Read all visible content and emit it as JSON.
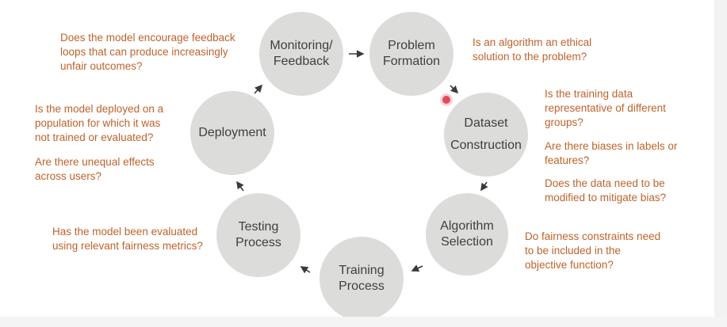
{
  "stages": [
    {
      "id": "monitoring",
      "lines": [
        "Monitoring/",
        "Feedback"
      ]
    },
    {
      "id": "problem",
      "lines": [
        "Problem",
        "Formation"
      ]
    },
    {
      "id": "dataset",
      "lines": [
        "Dataset",
        "Construction"
      ]
    },
    {
      "id": "algorithm",
      "lines": [
        "Algorithm",
        "Selection"
      ]
    },
    {
      "id": "training",
      "lines": [
        "Training",
        "Process"
      ]
    },
    {
      "id": "testing",
      "lines": [
        "Testing",
        "Process"
      ]
    },
    {
      "id": "deployment",
      "lines": [
        "Deployment"
      ]
    }
  ],
  "questions": {
    "monitoring": [
      "Does the model encourage feedback",
      "loops that can produce increasingly",
      "unfair outcomes?"
    ],
    "problem": [
      "Is an algorithm an ethical",
      "solution to the problem?"
    ],
    "dataset_1": [
      "Is the training data",
      "representative of different",
      "groups?"
    ],
    "dataset_2": [
      "Are there biases in labels or",
      "features?"
    ],
    "dataset_3": [
      "Does the data need to be",
      "modified to mitigate bias?"
    ],
    "algorithm": [
      "Do fairness constraints need",
      "to be included in the",
      "objective function?"
    ],
    "testing": [
      "Has the model been evaluated",
      "using relevant fairness metrics?"
    ],
    "deployment_1": [
      "Is the model deployed on a",
      "population for which it was",
      "not trained or evaluated?"
    ],
    "deployment_2": [
      "Are there unequal effects",
      "across users?"
    ]
  },
  "colors": {
    "circle_fill": "#dcdcdb",
    "stage_text": "#3f3f3f",
    "question_text": "#c0622b",
    "arrow": "#3a3a3a"
  }
}
